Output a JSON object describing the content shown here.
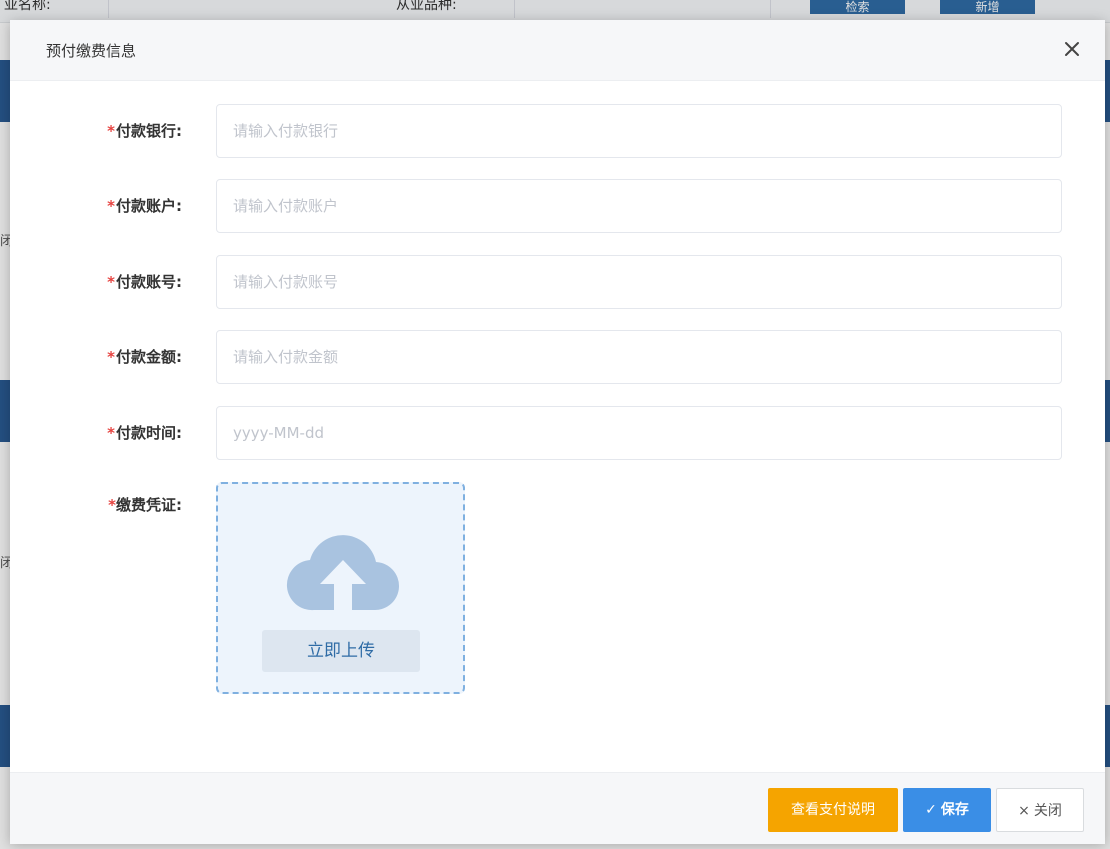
{
  "background": {
    "top_texts": [
      "亚名称:",
      "从业品种:"
    ],
    "top_buttons": [
      "检索",
      "新增"
    ],
    "side_fragments": [
      "闭",
      "闭"
    ]
  },
  "dialog": {
    "title": "预付缴费信息",
    "close_icon": "close-icon"
  },
  "form": {
    "required_mark": "*",
    "fields": [
      {
        "label": "付款银行:",
        "placeholder": "请输入付款银行",
        "value": ""
      },
      {
        "label": "付款账户:",
        "placeholder": "请输入付款账户",
        "value": ""
      },
      {
        "label": "付款账号:",
        "placeholder": "请输入付款账号",
        "value": ""
      },
      {
        "label": "付款金额:",
        "placeholder": "请输入付款金额",
        "value": ""
      },
      {
        "label": "付款时间:",
        "placeholder": "yyyy-MM-dd",
        "value": ""
      }
    ],
    "upload": {
      "label": "缴费凭证:",
      "icon": "cloud-upload-icon",
      "button_label": "立即上传"
    }
  },
  "footer": {
    "pay_info_label": "查看支付说明",
    "save_icon": "✓",
    "save_label": "保存",
    "close_icon": "×",
    "close_label": "关闭"
  },
  "colors": {
    "required": "#e64340",
    "primary": "#3a8ee6",
    "warning": "#f5a400",
    "upload_border": "#7fb0e0",
    "upload_bg": "#edf4fc",
    "cloud": "#a9c3e0"
  }
}
